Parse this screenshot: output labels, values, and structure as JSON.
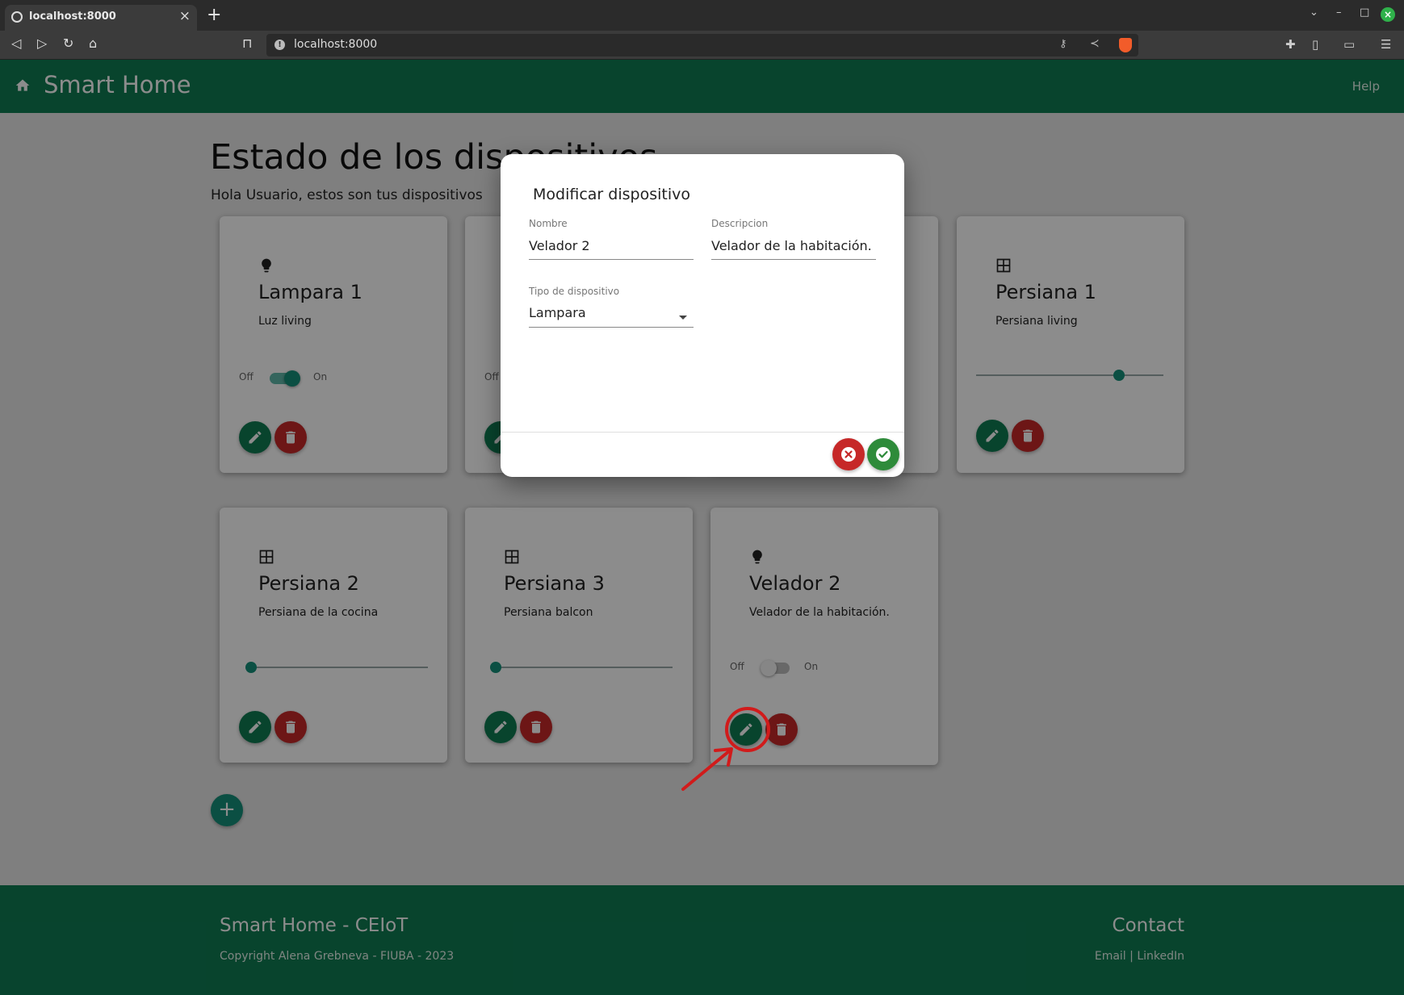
{
  "browser": {
    "tab_title": "localhost:8000",
    "url": "localhost:8000"
  },
  "app": {
    "brand": "Smart Home",
    "help_label": "Help"
  },
  "page": {
    "title": "Estado de los dispositivos",
    "subtitle": "Hola Usuario, estos son tus dispositivos"
  },
  "toggle_labels": {
    "off": "Off",
    "on": "On"
  },
  "devices": [
    {
      "icon": "lightbulb-icon",
      "name": "Lampara 1",
      "description": "Luz living",
      "control": "switch",
      "on": true
    },
    {
      "icon": "lightbulb-icon",
      "name": "",
      "description": "",
      "control": "switch",
      "on": false
    },
    {
      "icon": "lightbulb-icon",
      "name": "",
      "description": "",
      "control": "switch",
      "on": false
    },
    {
      "icon": "window-icon",
      "name": "Persiana 1",
      "description": "Persiana living",
      "control": "slider",
      "level": 0.78
    },
    {
      "icon": "window-icon",
      "name": "Persiana 2",
      "description": "Persiana de la cocina",
      "control": "slider",
      "level": 0.0
    },
    {
      "icon": "window-icon",
      "name": "Persiana 3",
      "description": "Persiana balcon",
      "control": "slider",
      "level": 0.0
    },
    {
      "icon": "lightbulb-icon",
      "name": "Velador 2",
      "description": "Velador de la habitación.",
      "control": "switch",
      "on": false
    }
  ],
  "dialog": {
    "title": "Modificar dispositivo",
    "name_label": "Nombre",
    "name_value": "Velador 2",
    "description_label": "Descripcion",
    "description_value": "Velador de la habitación.",
    "type_label": "Tipo de dispositivo",
    "type_value": "Lampara"
  },
  "footer": {
    "title": "Smart Home - CEIoT",
    "copyright": "Copyright Alena Grebneva - FIUBA - 2023",
    "contact_title": "Contact",
    "email_label": "Email",
    "separator": " | ",
    "linkedin_label": "LinkedIn"
  },
  "colors": {
    "primary": "#0f7c53",
    "accent": "#14917b",
    "danger": "#c62828",
    "confirm": "#2e8b3a",
    "annotation": "#d11b1b"
  }
}
